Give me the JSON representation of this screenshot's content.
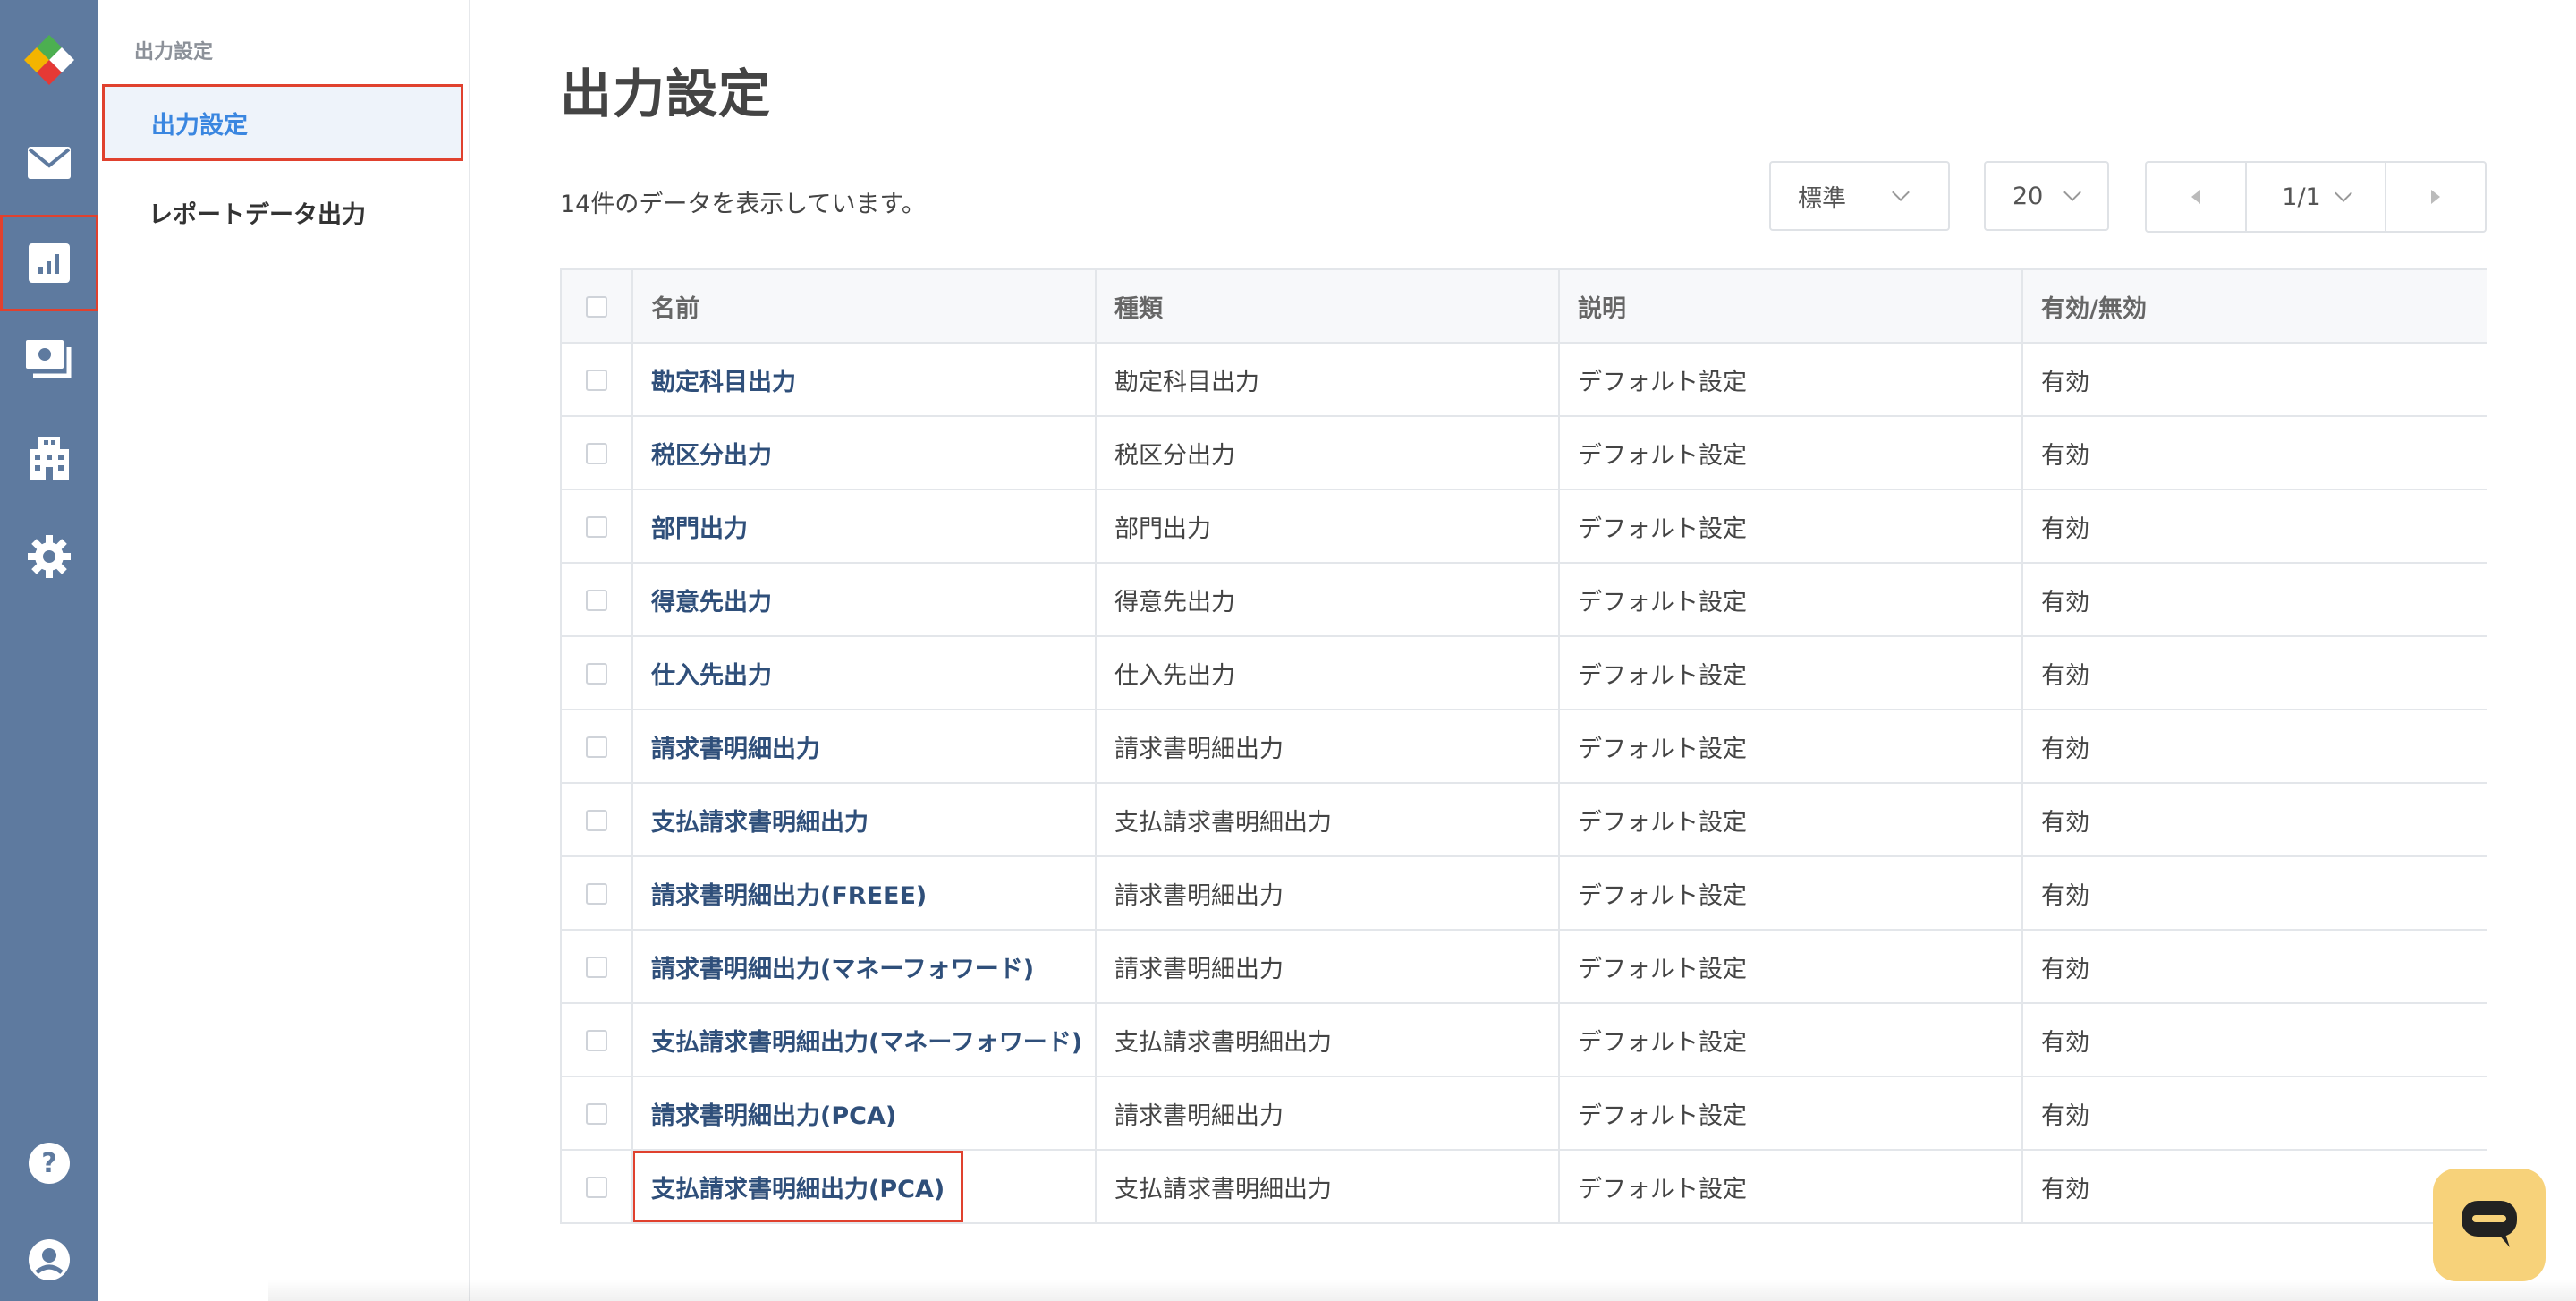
{
  "sidebar_rail": {
    "icons": [
      "logo-icon",
      "mail-icon",
      "report-chart-icon",
      "billing-icon",
      "building-icon",
      "gear-icon",
      "help-icon",
      "user-icon"
    ],
    "active": "report-chart-icon",
    "color": "#5e7a9f"
  },
  "subnav": {
    "section": "出力設定",
    "items": [
      {
        "label": "出力設定",
        "active": true
      },
      {
        "label": "レポートデータ出力",
        "active": false
      }
    ]
  },
  "page": {
    "title": "出力設定",
    "count_text": "14件のデータを表示しています。"
  },
  "controls": {
    "view_select": "標準",
    "per_page": "20",
    "page_indicator": "1/1"
  },
  "table": {
    "headers": [
      "名前",
      "種類",
      "説明",
      "有効/無効"
    ],
    "rows": [
      {
        "name": "勘定科目出力",
        "type": "勘定科目出力",
        "desc": "デフォルト設定",
        "status": "有効"
      },
      {
        "name": "税区分出力",
        "type": "税区分出力",
        "desc": "デフォルト設定",
        "status": "有効"
      },
      {
        "name": "部門出力",
        "type": "部門出力",
        "desc": "デフォルト設定",
        "status": "有効"
      },
      {
        "name": "得意先出力",
        "type": "得意先出力",
        "desc": "デフォルト設定",
        "status": "有効"
      },
      {
        "name": "仕入先出力",
        "type": "仕入先出力",
        "desc": "デフォルト設定",
        "status": "有効"
      },
      {
        "name": "請求書明細出力",
        "type": "請求書明細出力",
        "desc": "デフォルト設定",
        "status": "有効"
      },
      {
        "name": "支払請求書明細出力",
        "type": "支払請求書明細出力",
        "desc": "デフォルト設定",
        "status": "有効"
      },
      {
        "name": "請求書明細出力(FREEE)",
        "type": "請求書明細出力",
        "desc": "デフォルト設定",
        "status": "有効"
      },
      {
        "name": "請求書明細出力(マネーフォワード)",
        "type": "請求書明細出力",
        "desc": "デフォルト設定",
        "status": "有効"
      },
      {
        "name": "支払請求書明細出力(マネーフォワード)",
        "type": "支払請求書明細出力",
        "desc": "デフォルト設定",
        "status": "有効"
      },
      {
        "name": "請求書明細出力(PCA)",
        "type": "請求書明細出力",
        "desc": "デフォルト設定",
        "status": "有効"
      },
      {
        "name": "支払請求書明細出力(PCA)",
        "type": "支払請求書明細出力",
        "desc": "デフォルト設定",
        "status": "有効",
        "highlighted": true
      }
    ]
  },
  "chat_button": {
    "icon": "chat-bubble-icon",
    "color": "#f7d27a"
  }
}
